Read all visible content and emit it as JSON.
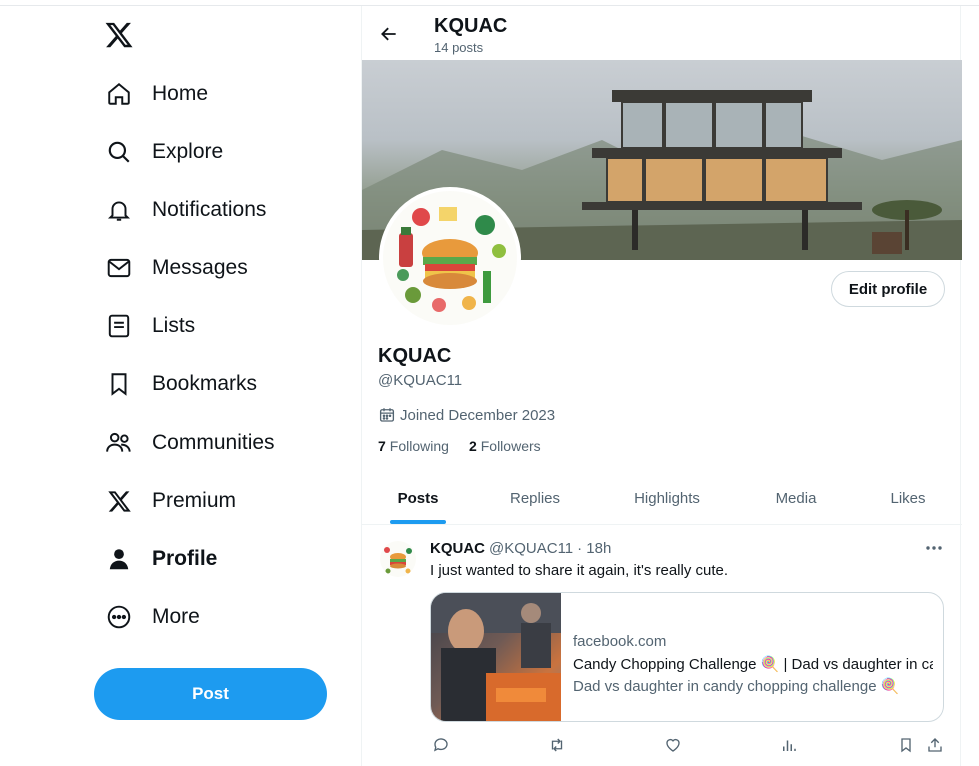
{
  "nav": {
    "items": [
      {
        "label": "Home",
        "icon": "home-icon"
      },
      {
        "label": "Explore",
        "icon": "search-icon"
      },
      {
        "label": "Notifications",
        "icon": "bell-icon"
      },
      {
        "label": "Messages",
        "icon": "envelope-icon"
      },
      {
        "label": "Lists",
        "icon": "list-icon"
      },
      {
        "label": "Bookmarks",
        "icon": "bookmark-icon"
      },
      {
        "label": "Communities",
        "icon": "people-icon"
      },
      {
        "label": "Premium",
        "icon": "x-logo-icon"
      },
      {
        "label": "Profile",
        "icon": "person-icon",
        "active": true
      },
      {
        "label": "More",
        "icon": "more-circle-icon"
      }
    ],
    "post_label": "Post"
  },
  "header": {
    "title": "KQUAC",
    "subtitle": "14 posts"
  },
  "profile": {
    "name": "KQUAC",
    "handle": "@KQUAC11",
    "joined": "Joined December 2023",
    "following_count": "7",
    "following_label": "Following",
    "followers_count": "2",
    "followers_label": "Followers",
    "edit_label": "Edit profile"
  },
  "tabs": [
    {
      "label": "Posts",
      "active": true
    },
    {
      "label": "Replies"
    },
    {
      "label": "Highlights"
    },
    {
      "label": "Media"
    },
    {
      "label": "Likes"
    }
  ],
  "tweet": {
    "name": "KQUAC",
    "handle": "@KQUAC11",
    "time": "· 18h",
    "text": "I just wanted to share it again, it's really cute.",
    "card": {
      "domain": "facebook.com",
      "title": "Candy Chopping Challenge 🍭 | Dad vs daughter in candy chopping challenge",
      "description": "Dad vs daughter in candy chopping challenge 🍭"
    }
  },
  "colors": {
    "accent": "#1d9bf0",
    "text": "#0f1419",
    "muted": "#536471",
    "border": "#cfd9de"
  }
}
